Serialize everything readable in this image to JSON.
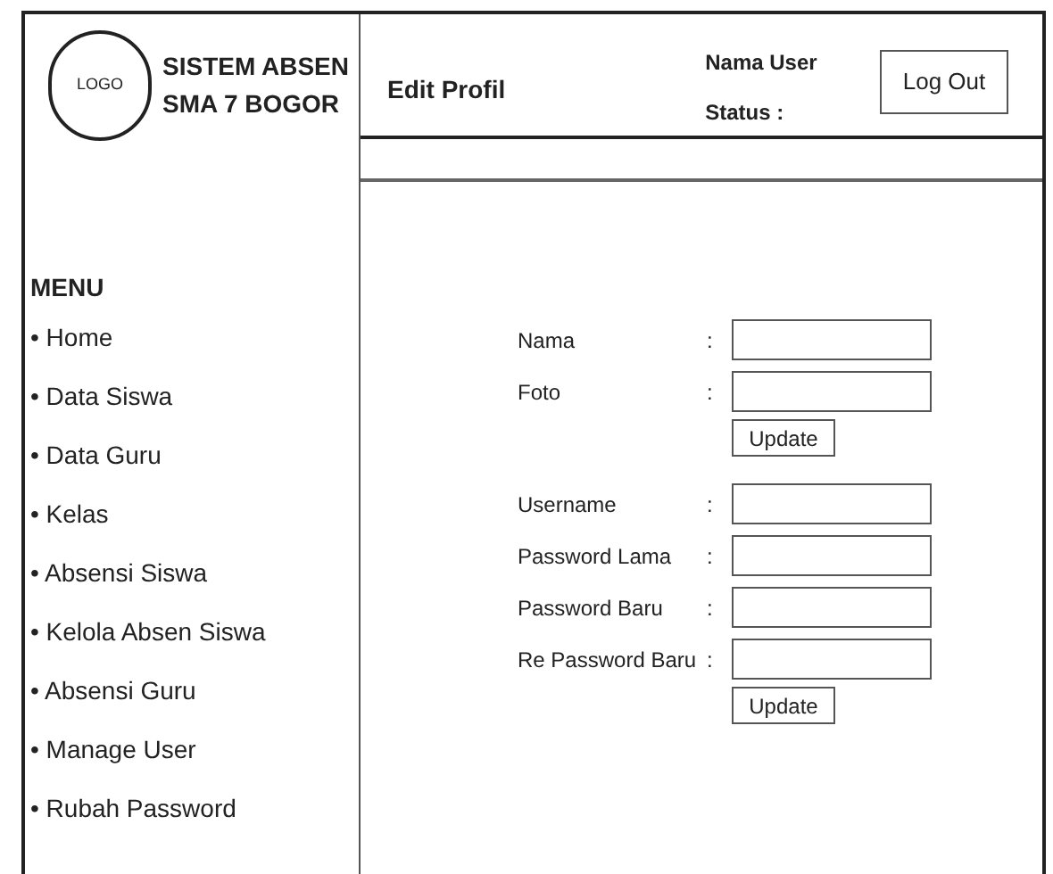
{
  "header": {
    "logo": "LOGO",
    "app_title": [
      "SISTEM ABSEN",
      "SMA 7 BOGOR"
    ],
    "page_title": "Edit Profil",
    "user_name": "Nama User",
    "status": "Status :",
    "logout_button": "Log Out"
  },
  "sidebar": {
    "heading": "MENU",
    "items": [
      {
        "label": "• Home"
      },
      {
        "label": "• Data Siswa"
      },
      {
        "label": "• Data Guru"
      },
      {
        "label": "• Kelas"
      },
      {
        "label": "• Absensi Siswa"
      },
      {
        "label": "• Kelola Absen Siswa"
      },
      {
        "label": "• Absensi Guru"
      },
      {
        "label": "• Manage User"
      },
      {
        "label": "• Rubah Password"
      }
    ]
  },
  "forms": [
    {
      "fields": [
        {
          "label": "Nama",
          "colon": ":"
        },
        {
          "label": "Foto",
          "colon": ":"
        }
      ],
      "button": "Update"
    },
    {
      "fields": [
        {
          "label": "Username",
          "colon": ":"
        },
        {
          "label": "Password Lama",
          "colon": ":"
        },
        {
          "label": "Password Baru",
          "colon": ":"
        },
        {
          "label": "Re Password  Baru",
          "colon": ":"
        }
      ],
      "button": "Update"
    }
  ]
}
